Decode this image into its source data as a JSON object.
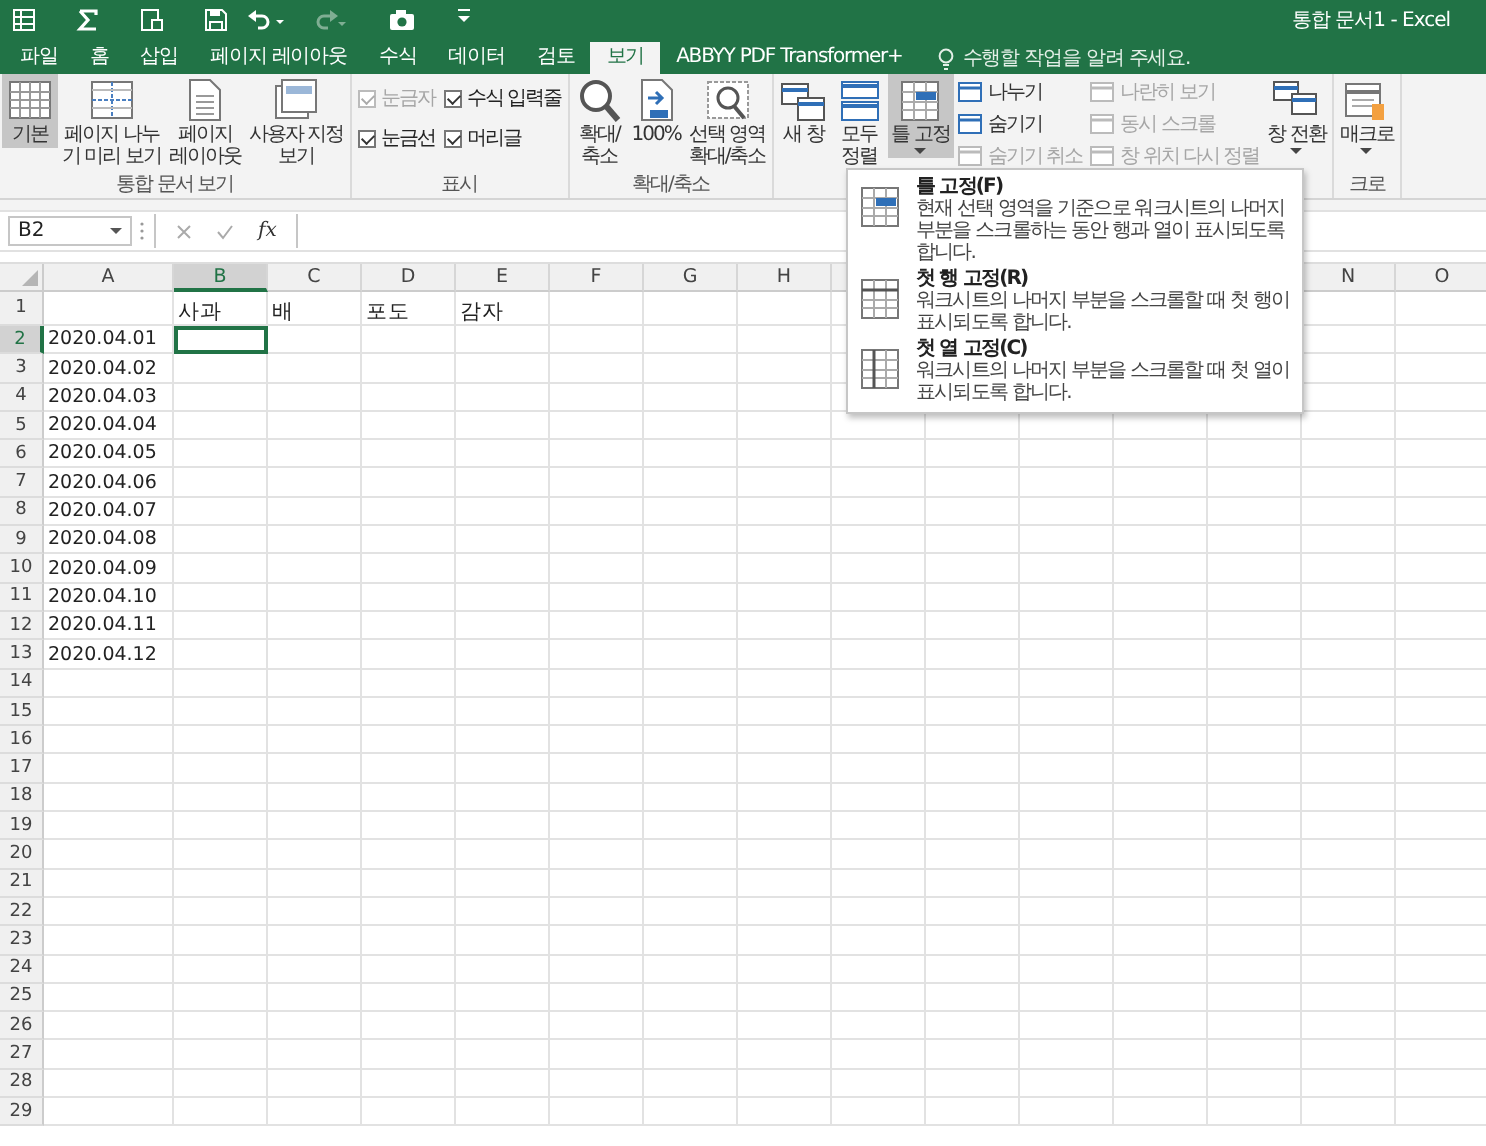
{
  "window": {
    "title": "통합 문서1 - Excel"
  },
  "quick_access": [
    {
      "kind": "sheet"
    },
    {
      "kind": "sum"
    },
    {
      "kind": "form"
    },
    {
      "kind": "save"
    },
    {
      "kind": "undo"
    },
    {
      "kind": "redo"
    },
    {
      "kind": "camera"
    },
    {
      "kind": "customize"
    }
  ],
  "tabs": [
    {
      "label": "파일",
      "selected": false
    },
    {
      "label": "홈",
      "selected": false
    },
    {
      "label": "삽입",
      "selected": false
    },
    {
      "label": "페이지 레이아웃",
      "selected": false
    },
    {
      "label": "수식",
      "selected": false
    },
    {
      "label": "데이터",
      "selected": false
    },
    {
      "label": "검토",
      "selected": false
    },
    {
      "label": "보기",
      "selected": true
    },
    {
      "label": "ABBYY PDF Transformer+",
      "selected": false
    }
  ],
  "tell_me": {
    "placeholder": "수행할 작업을 알려 주세요."
  },
  "ribbon_groups": [
    {
      "label": "통합 문서 보기",
      "items": [
        {
          "kind": "large",
          "label": "기본",
          "selected": true
        },
        {
          "kind": "large",
          "label": "페이지 나누\n기 미리 보기",
          "selected": false
        },
        {
          "kind": "large",
          "label": "페이지\n레이아웃",
          "selected": false
        },
        {
          "kind": "large",
          "label": "사용자 지정\n보기",
          "selected": false
        }
      ]
    },
    {
      "label": "표시",
      "items": [
        {
          "kind": "checks",
          "checks": [
            {
              "label": "눈금자",
              "checked": true,
              "disabled": true
            },
            {
              "label": "눈금선",
              "checked": true,
              "disabled": false
            }
          ]
        },
        {
          "kind": "checks",
          "checks": [
            {
              "label": "수식 입력줄",
              "checked": true,
              "disabled": false
            },
            {
              "label": "머리글",
              "checked": true,
              "disabled": false
            }
          ]
        }
      ]
    },
    {
      "label": "확대/축소",
      "items": [
        {
          "kind": "large",
          "label": "확대/\n축소",
          "selected": false
        },
        {
          "kind": "large",
          "label": "100%",
          "selected": false
        },
        {
          "kind": "large",
          "label": "선택 영역\n확대/축소",
          "selected": false
        }
      ]
    },
    {
      "items": [
        {
          "kind": "large",
          "label": "새 창",
          "selected": false
        },
        {
          "kind": "large",
          "label": "모두\n정렬",
          "selected": false
        },
        {
          "kind": "large",
          "label": "틀 고정",
          "selected": true,
          "dropdown": true
        },
        {
          "kind": "small",
          "buttons": [
            {
              "label": "나누기",
              "disabled": false
            },
            {
              "label": "숨기기",
              "disabled": false
            },
            {
              "label": "숨기기 취소",
              "disabled": true
            }
          ]
        },
        {
          "kind": "small",
          "buttons": [
            {
              "label": "나란히 보기",
              "disabled": true
            },
            {
              "label": "동시 스크롤",
              "disabled": true
            },
            {
              "label": "창 위치 다시 정렬",
              "disabled": true
            }
          ]
        },
        {
          "kind": "large",
          "label": "창 전환",
          "selected": false,
          "dropdown": true
        }
      ]
    },
    {
      "label": "크로",
      "items": [
        {
          "kind": "large",
          "label": "매크로",
          "selected": false,
          "dropdown": true
        }
      ]
    }
  ],
  "formula_bar": {
    "name_box": "B2",
    "function_label": "fx"
  },
  "columns": [
    {
      "label": "A",
      "selected": false
    },
    {
      "label": "B",
      "selected": true
    },
    {
      "label": "C",
      "selected": false
    },
    {
      "label": "D",
      "selected": false
    },
    {
      "label": "E",
      "selected": false
    },
    {
      "label": "F",
      "selected": false
    },
    {
      "label": "G",
      "selected": false
    },
    {
      "label": "H",
      "selected": false
    },
    {},
    {},
    {},
    {},
    {},
    {
      "label": "N",
      "selected": false
    },
    {
      "label": "O",
      "selected": false
    }
  ],
  "rows": [
    {
      "label": "1",
      "selected": false,
      "cells": [
        {},
        {
          "text": "사과"
        },
        {
          "text": "배"
        },
        {
          "text": "포도"
        },
        {
          "text": "감자"
        }
      ]
    },
    {
      "label": "2",
      "selected": true,
      "cells": [
        {
          "text": "2020.04.01"
        },
        {
          "selected": true
        }
      ]
    },
    {
      "label": "3",
      "selected": false,
      "cells": [
        {
          "text": "2020.04.02"
        }
      ]
    },
    {
      "label": "4",
      "selected": false,
      "cells": [
        {
          "text": "2020.04.03"
        }
      ]
    },
    {
      "label": "5",
      "selected": false,
      "cells": [
        {
          "text": "2020.04.04"
        }
      ]
    },
    {
      "label": "6",
      "selected": false,
      "cells": [
        {
          "text": "2020.04.05"
        }
      ]
    },
    {
      "label": "7",
      "selected": false,
      "cells": [
        {
          "text": "2020.04.06"
        }
      ]
    },
    {
      "label": "8",
      "selected": false,
      "cells": [
        {
          "text": "2020.04.07"
        }
      ]
    },
    {
      "label": "9",
      "selected": false,
      "cells": [
        {
          "text": "2020.04.08"
        }
      ]
    },
    {
      "label": "10",
      "selected": false,
      "cells": [
        {
          "text": "2020.04.09"
        }
      ]
    },
    {
      "label": "11",
      "selected": false,
      "cells": [
        {
          "text": "2020.04.10"
        }
      ]
    },
    {
      "label": "12",
      "selected": false,
      "cells": [
        {
          "text": "2020.04.11"
        }
      ]
    },
    {
      "label": "13",
      "selected": false,
      "cells": [
        {
          "text": "2020.04.12"
        }
      ]
    },
    {
      "label": "14",
      "selected": false,
      "cells": []
    },
    {
      "label": "15",
      "selected": false,
      "cells": []
    },
    {
      "label": "16",
      "selected": false,
      "cells": []
    },
    {
      "label": "17",
      "selected": false,
      "cells": []
    },
    {
      "label": "18",
      "selected": false,
      "cells": []
    },
    {
      "label": "19",
      "selected": false,
      "cells": []
    },
    {
      "label": "20",
      "selected": false,
      "cells": []
    },
    {
      "label": "21",
      "selected": false,
      "cells": []
    },
    {
      "label": "22",
      "selected": false,
      "cells": []
    },
    {
      "label": "23",
      "selected": false,
      "cells": []
    },
    {
      "label": "24",
      "selected": false,
      "cells": []
    },
    {
      "label": "25",
      "selected": false,
      "cells": []
    },
    {
      "label": "26",
      "selected": false,
      "cells": []
    },
    {
      "label": "27",
      "selected": false,
      "cells": []
    },
    {
      "label": "28",
      "selected": false,
      "cells": []
    },
    {
      "label": "29",
      "selected": false,
      "cells": []
    }
  ],
  "freeze_menu": {
    "items": [
      {
        "title": "틀 고정(F)",
        "description": "현재 선택 영역을 기준으로 워크시트의 나머지 부분을 스크롤하는 동안 행과 열이 표시되도록 합니다."
      },
      {
        "title": "첫 행 고정(R)",
        "description": "워크시트의 나머지 부분을 스크롤할 때 첫 행이 표시되도록 합니다."
      },
      {
        "title": "첫 열 고정(C)",
        "description": "워크시트의 나머지 부분을 스크롤할 때 첫 열이 표시되도록 합니다."
      }
    ]
  }
}
